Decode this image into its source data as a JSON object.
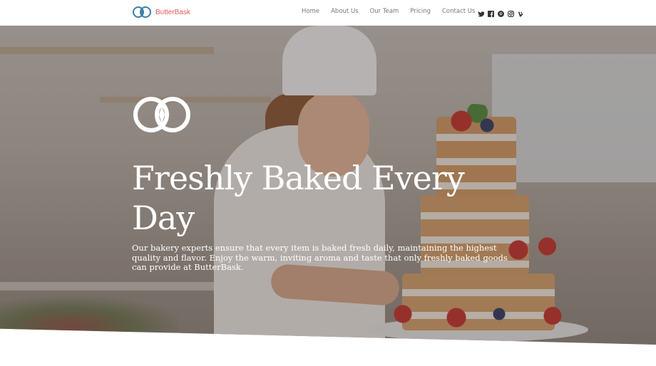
{
  "brand": {
    "name": "ButterBask",
    "logo_icon": "butterbask-logo-icon",
    "accent": "#e05a5a",
    "logo_color": "#3b7fa6"
  },
  "nav": {
    "items": [
      "Home",
      "About Us",
      "Our Team",
      "Pricing",
      "Contact Us"
    ]
  },
  "social": {
    "icons": [
      "twitter-icon",
      "facebook-icon",
      "pinterest-icon",
      "instagram-icon",
      "vine-icon"
    ]
  },
  "hero": {
    "title": "Freshly Baked Every Day",
    "description": "Our bakery experts ensure that every item is baked fresh daily, maintaining the highest quality and flavor. Enjoy the warm, inviting aroma and taste that only freshly baked goods can provide at ButterBask.",
    "logo_icon": "butterbask-logo-icon"
  }
}
